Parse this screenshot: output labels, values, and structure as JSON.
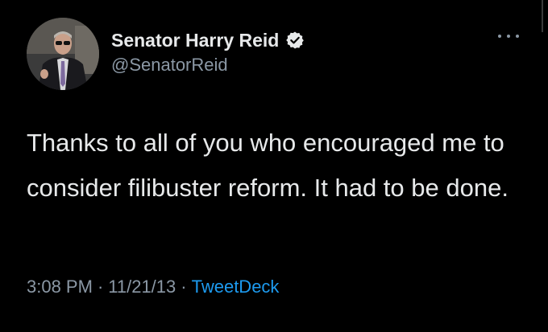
{
  "tweet": {
    "display_name": "Senator Harry Reid",
    "handle": "@SenatorReid",
    "text": "Thanks to all of you who encouraged me to consider filibuster reform. It had to be done.",
    "time": "3:08 PM",
    "date": "11/21/13",
    "separator": "·",
    "source": "TweetDeck"
  },
  "icons": {
    "verified": "verified-badge-icon",
    "more": "more-options-icon"
  },
  "colors": {
    "background": "#000000",
    "text": "#e7e9ea",
    "secondary": "#8b98a5",
    "link": "#1d9bf0"
  }
}
